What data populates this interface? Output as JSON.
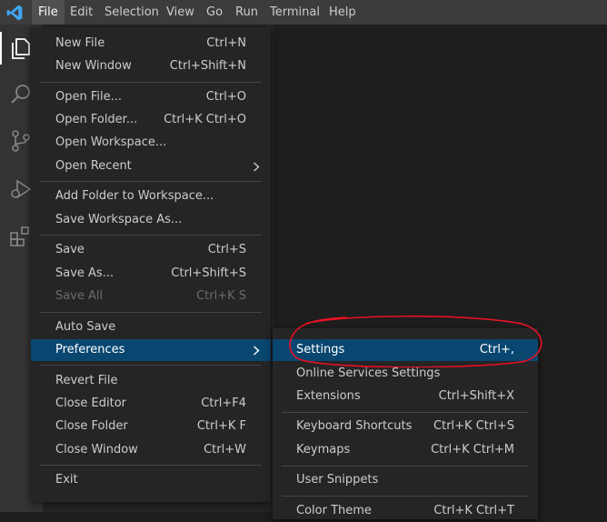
{
  "menubar": {
    "items": [
      "File",
      "Edit",
      "Selection",
      "View",
      "Go",
      "Run",
      "Terminal",
      "Help"
    ]
  },
  "activity_icons": [
    "explorer-icon",
    "search-icon",
    "source-control-icon",
    "run-debug-icon",
    "extensions-icon"
  ],
  "file_menu": {
    "new_file": {
      "label": "New File",
      "key": "Ctrl+N"
    },
    "new_window": {
      "label": "New Window",
      "key": "Ctrl+Shift+N"
    },
    "open_file": {
      "label": "Open File...",
      "key": "Ctrl+O"
    },
    "open_folder": {
      "label": "Open Folder...",
      "key": "Ctrl+K Ctrl+O"
    },
    "open_workspace": {
      "label": "Open Workspace..."
    },
    "open_recent": {
      "label": "Open Recent"
    },
    "add_folder": {
      "label": "Add Folder to Workspace..."
    },
    "save_workspace_as": {
      "label": "Save Workspace As..."
    },
    "save": {
      "label": "Save",
      "key": "Ctrl+S"
    },
    "save_as": {
      "label": "Save As...",
      "key": "Ctrl+Shift+S"
    },
    "save_all": {
      "label": "Save All",
      "key": "Ctrl+K S"
    },
    "auto_save": {
      "label": "Auto Save"
    },
    "preferences": {
      "label": "Preferences"
    },
    "revert_file": {
      "label": "Revert File"
    },
    "close_editor": {
      "label": "Close Editor",
      "key": "Ctrl+F4"
    },
    "close_folder": {
      "label": "Close Folder",
      "key": "Ctrl+K F"
    },
    "close_window": {
      "label": "Close Window",
      "key": "Ctrl+W"
    },
    "exit": {
      "label": "Exit"
    }
  },
  "preferences_menu": {
    "settings": {
      "label": "Settings",
      "key": "Ctrl+,"
    },
    "online_services": {
      "label": "Online Services Settings"
    },
    "extensions": {
      "label": "Extensions",
      "key": "Ctrl+Shift+X"
    },
    "keyboard_shortcuts": {
      "label": "Keyboard Shortcuts",
      "key": "Ctrl+K Ctrl+S"
    },
    "keymaps": {
      "label": "Keymaps",
      "key": "Ctrl+K Ctrl+M"
    },
    "user_snippets": {
      "label": "User Snippets"
    },
    "color_theme": {
      "label": "Color Theme",
      "key": "Ctrl+K Ctrl+T"
    }
  },
  "colors": {
    "highlight": "#094771",
    "annotation": "#e81123",
    "accent": "#007acc"
  }
}
